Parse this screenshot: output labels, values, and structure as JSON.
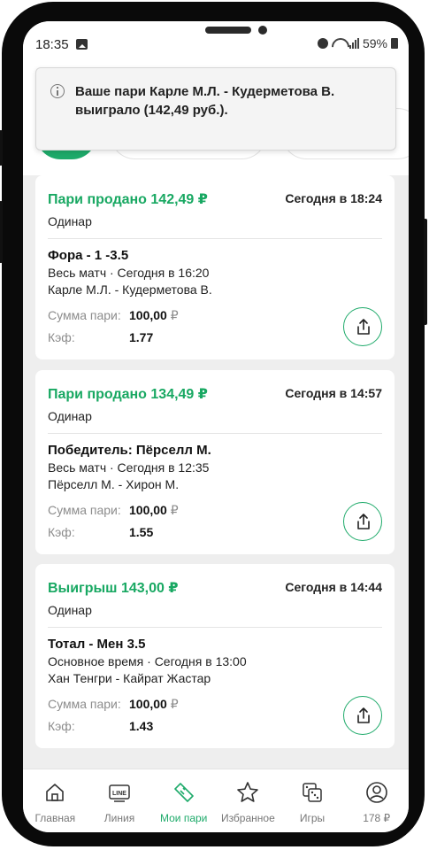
{
  "status_bar": {
    "time": "18:35",
    "battery": "59%"
  },
  "toast": {
    "message": "Ваше пари Карле М.Л. - Кудерметова В. выиграло (142,49 руб.)."
  },
  "bets": [
    {
      "status": "Пари продано 142,49 ₽",
      "date": "Сегодня в 18:24",
      "type": "Одинар",
      "market": "Фора - 1 -3.5",
      "period": "Весь матч · Сегодня в 16:20",
      "event": "Карле М.Л. - Кудерметова В.",
      "stake_label": "Сумма пари:",
      "stake_value": "100,00",
      "currency": "₽",
      "coef_label": "Кэф:",
      "coef_value": "1.77"
    },
    {
      "status": "Пари продано 134,49 ₽",
      "date": "Сегодня в 14:57",
      "type": "Одинар",
      "market": "Победитель: Пёрселл М.",
      "period": "Весь матч · Сегодня в 12:35",
      "event": "Пёрселл М. - Хирон М.",
      "stake_label": "Сумма пари:",
      "stake_value": "100,00",
      "currency": "₽",
      "coef_label": "Кэф:",
      "coef_value": "1.55"
    },
    {
      "status": "Выигрыш 143,00 ₽",
      "date": "Сегодня в 14:44",
      "type": "Одинар",
      "market": "Тотал - Мен 3.5",
      "period": "Основное время · Сегодня в 13:00",
      "event": "Хан Тенгри - Кайрат Жастар",
      "stake_label": "Сумма пари:",
      "stake_value": "100,00",
      "currency": "₽",
      "coef_label": "Кэф:",
      "coef_value": "1.43"
    }
  ],
  "nav": {
    "home": "Главная",
    "line": "Линия",
    "line_icon_text": "LINE",
    "my_bets": "Мои пари",
    "favorites": "Избранное",
    "games": "Игры",
    "balance": "178 ₽"
  },
  "colors": {
    "accent": "#1eaa6a",
    "win_text": "#18a862",
    "background": "#eeeeee"
  }
}
